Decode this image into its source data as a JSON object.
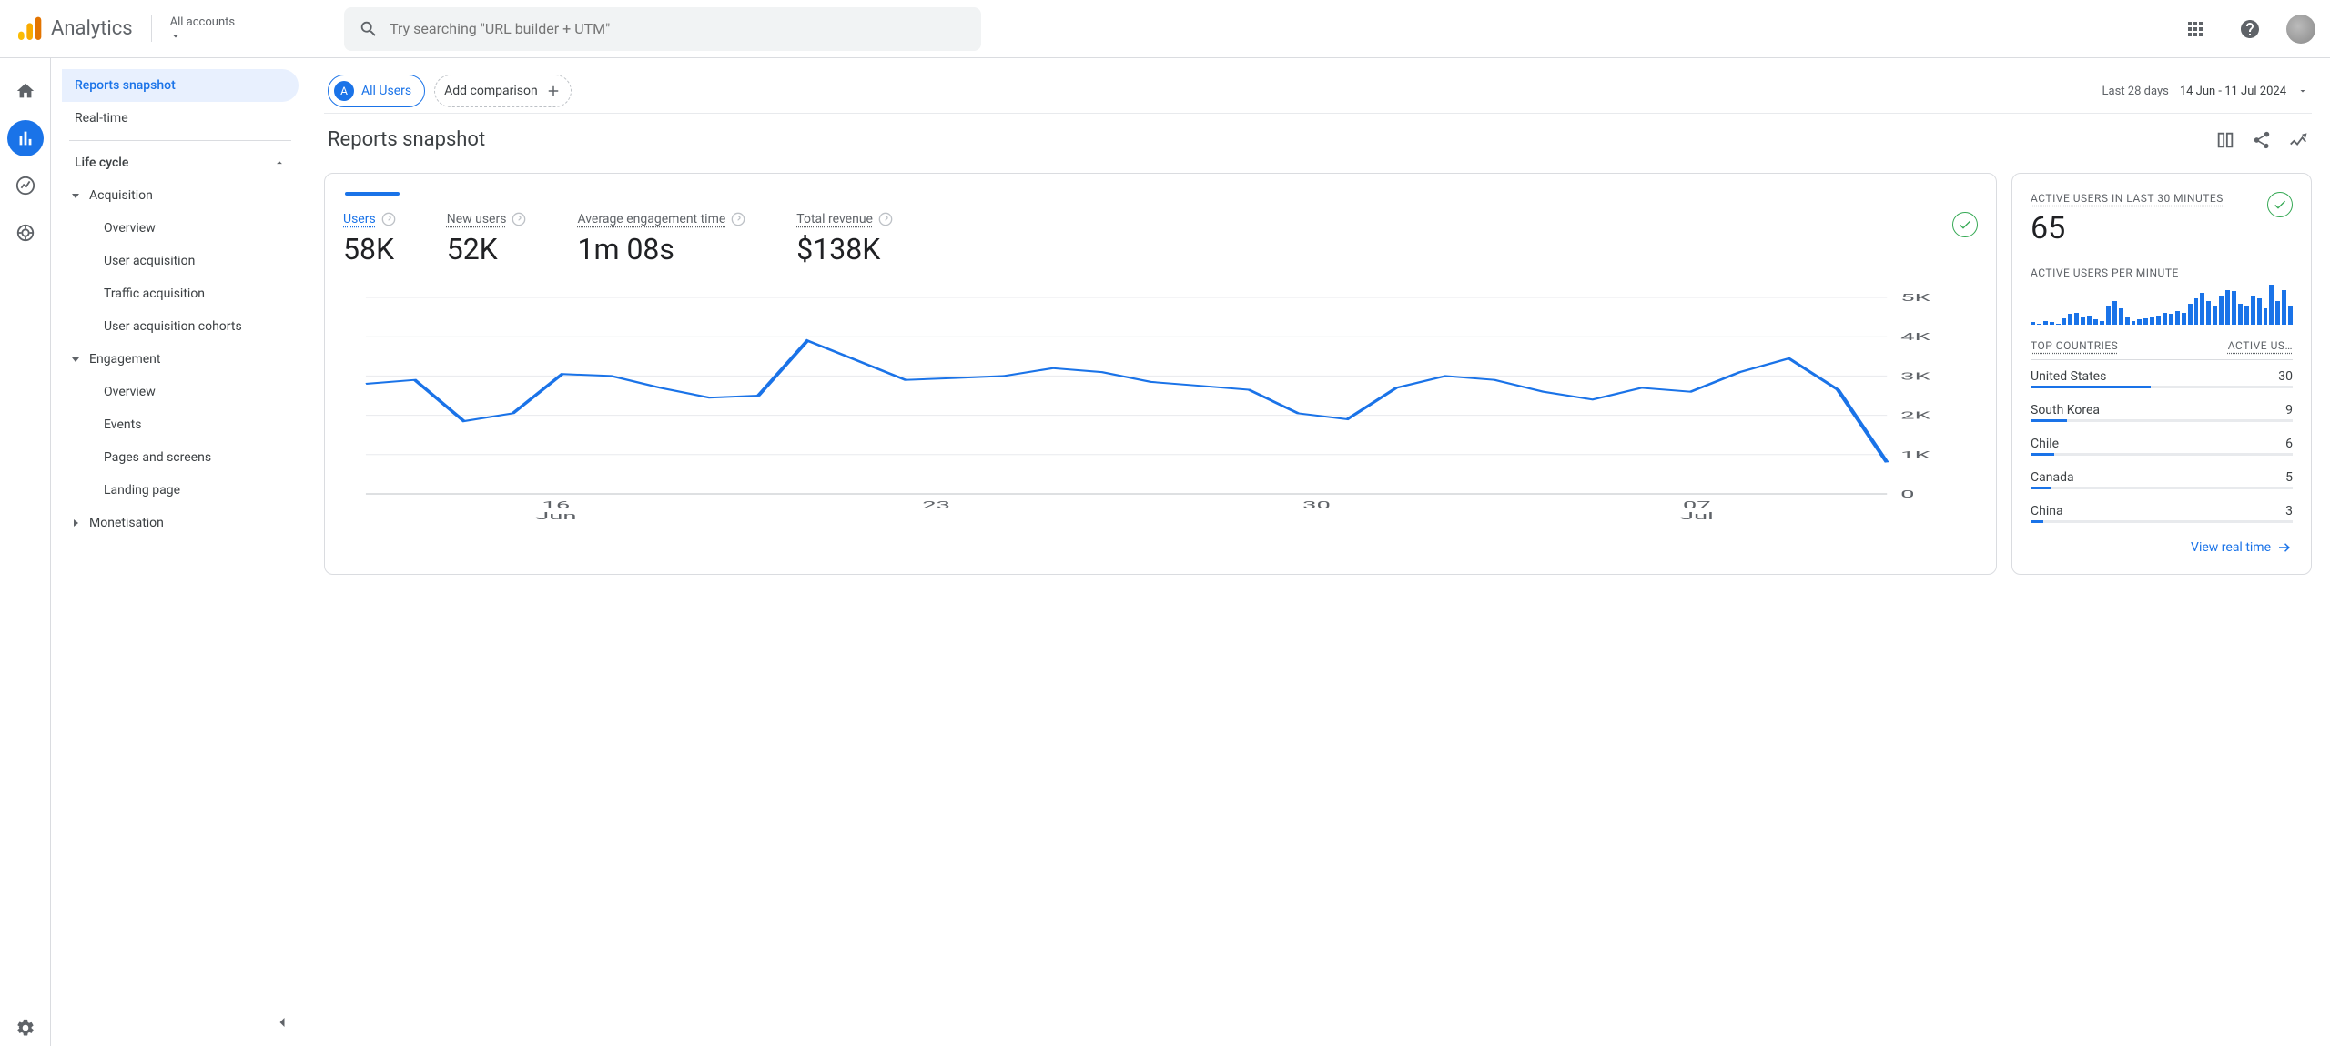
{
  "header": {
    "product": "Analytics",
    "account_label": "All accounts",
    "search_placeholder": "Try searching \"URL builder + UTM\""
  },
  "sidebar": {
    "reports_snapshot": "Reports snapshot",
    "realtime": "Real-time",
    "life_cycle": "Life cycle",
    "acquisition": {
      "label": "Acquisition",
      "overview": "Overview",
      "user_acquisition": "User acquisition",
      "traffic_acquisition": "Traffic acquisition",
      "user_acquisition_cohorts": "User acquisition cohorts"
    },
    "engagement": {
      "label": "Engagement",
      "overview": "Overview",
      "events": "Events",
      "pages_screens": "Pages and screens",
      "landing_page": "Landing page"
    },
    "monetisation": "Monetisation"
  },
  "topbar": {
    "all_users_badge": "A",
    "all_users_label": "All Users",
    "add_comparison": "Add comparison",
    "date_prefix": "Last 28 days",
    "date_range": "14 Jun - 11 Jul 2024"
  },
  "page_title": "Reports snapshot",
  "metrics": {
    "users_label": "Users",
    "users_value": "58K",
    "new_users_label": "New users",
    "new_users_value": "52K",
    "avg_engagement_label": "Average engagement time",
    "avg_engagement_value": "1m 08s",
    "total_revenue_label": "Total revenue",
    "total_revenue_value": "$138K"
  },
  "chart_data": {
    "type": "line",
    "ylim": [
      0,
      5000
    ],
    "y_ticks": [
      "0",
      "1K",
      "2K",
      "3K",
      "4K",
      "5K"
    ],
    "x_ticks": [
      "16\nJun",
      "23",
      "30",
      "07\nJul"
    ],
    "series": [
      {
        "name": "Users",
        "values": [
          2800,
          2900,
          1850,
          2050,
          3050,
          3000,
          2700,
          2450,
          2500,
          3900,
          3400,
          2900,
          2950,
          3000,
          3200,
          3100,
          2850,
          2750,
          2650,
          2050,
          1900,
          2700,
          3000,
          2900,
          2600,
          2400,
          2700,
          2600,
          3100,
          3450,
          2650,
          800
        ]
      }
    ]
  },
  "realtime": {
    "headline_label": "ACTIVE USERS IN LAST 30 MINUTES",
    "headline_value": "65",
    "per_minute_label": "ACTIVE USERS PER MINUTE",
    "per_minute_bars": [
      2,
      1,
      3,
      2,
      1,
      5,
      8,
      9,
      6,
      7,
      4,
      3,
      14,
      18,
      12,
      6,
      3,
      4,
      5,
      6,
      7,
      9,
      8,
      10,
      9,
      16,
      20,
      24,
      18,
      14,
      22,
      26,
      25,
      16,
      14,
      22,
      20,
      12,
      30,
      18,
      26,
      14
    ],
    "countries_head_left": "TOP COUNTRIES",
    "countries_head_right": "ACTIVE US…",
    "countries": [
      {
        "name": "United States",
        "value": "30",
        "pct": 46
      },
      {
        "name": "South Korea",
        "value": "9",
        "pct": 14
      },
      {
        "name": "Chile",
        "value": "6",
        "pct": 9
      },
      {
        "name": "Canada",
        "value": "5",
        "pct": 8
      },
      {
        "name": "China",
        "value": "3",
        "pct": 5
      }
    ],
    "footer_link": "View real time"
  }
}
